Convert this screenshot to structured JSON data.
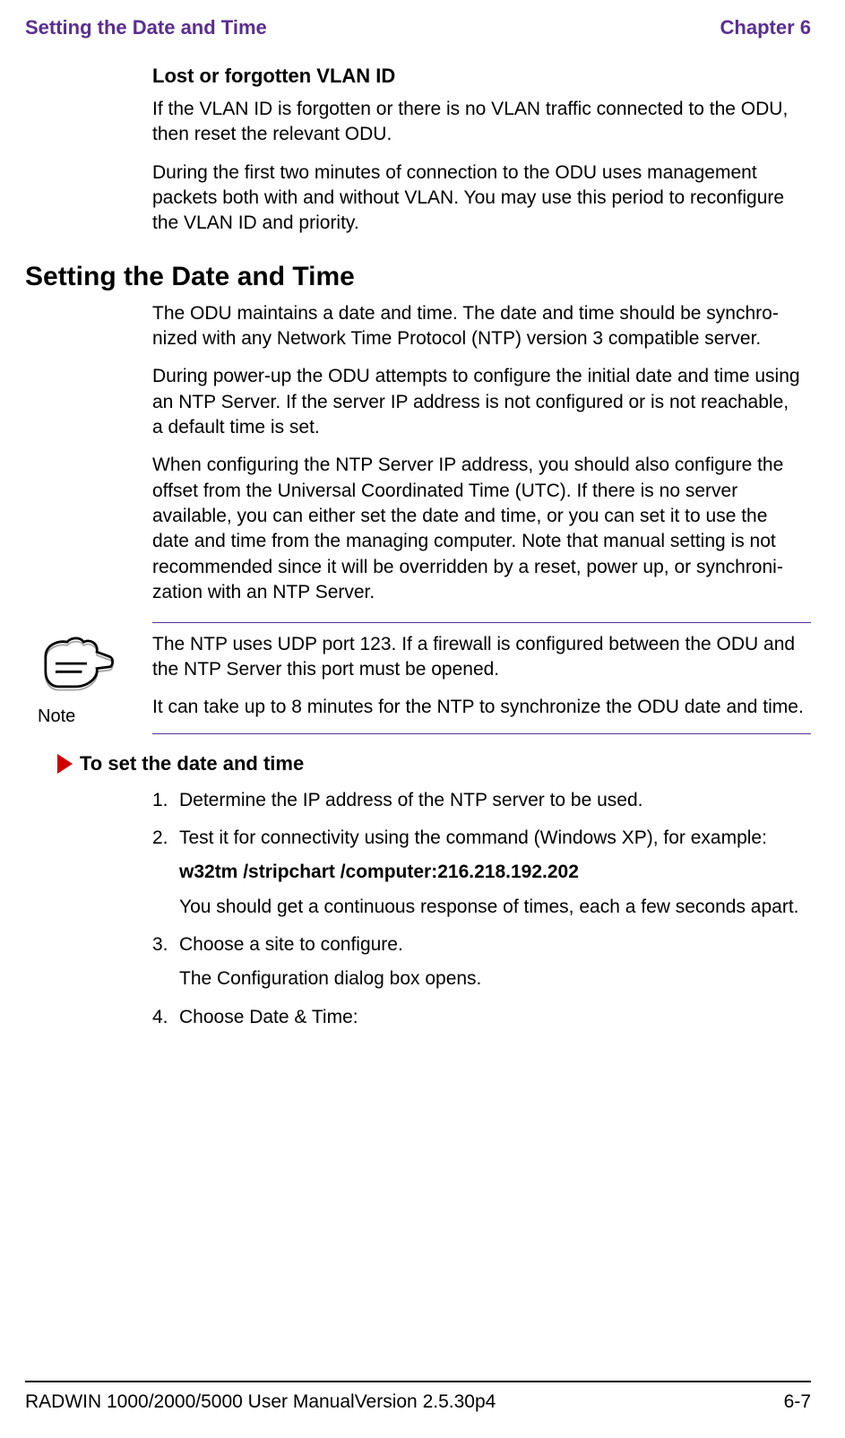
{
  "runhead": {
    "left": "Setting the Date and Time",
    "right": "Chapter 6"
  },
  "sec1": {
    "heading": "Lost or forgotten VLAN ID",
    "p1": "If the VLAN ID is forgotten or there is no VLAN traffic connected to the ODU, then reset the relevant ODU.",
    "p2": "During the first two minutes of connection to the ODU uses management packets both with and without VLAN. You may use this period to reconfigure the VLAN ID and priority."
  },
  "sec2": {
    "heading": "Setting the Date and Time",
    "p1": "The ODU maintains a date and time. The date and time should be synchro­nized with any Network Time Protocol (NTP) version 3 compatible server.",
    "p2": "During power-up the ODU attempts to configure the initial date and time using an NTP Server. If the server IP address is not configured or is not reachable, a default time is set.",
    "p3": "When configuring the NTP Server IP address, you should also configure the offset from the Universal Coordinated Time (UTC). If there is no server available, you can either set the date and time, or you can set it to use the date and time from the managing computer. Note that manual setting is not recommended since it will be overridden by a reset, power up, or synchroni­zation with an NTP Server."
  },
  "note": {
    "label": "Note",
    "p1": "The NTP uses UDP port 123. If a firewall is configured between the ODU and the NTP Server this port must be opened.",
    "p2": "It can take up to 8 minutes for the NTP to synchronize the ODU date and time."
  },
  "proc": {
    "title": "To set the date and time",
    "steps": {
      "s1": {
        "num": "1.",
        "text": "Determine the IP address of the NTP server to be used."
      },
      "s2": {
        "num": "2.",
        "text": " Test it for connectivity using the command (Windows XP), for example:",
        "cmd": "w32tm /stripchart /computer:216.218.192.202",
        "after": "You should get a continuous response of times, each a few seconds apart."
      },
      "s3": {
        "num": "3.",
        "text": "Choose a site to configure.",
        "after": "The Configuration dialog box opens."
      },
      "s4": {
        "num": "4.",
        "text": "Choose Date & Time:"
      }
    }
  },
  "footer": {
    "left": "RADWIN 1000/2000/5000 User ManualVersion  2.5.30p4",
    "right": "6-7"
  }
}
